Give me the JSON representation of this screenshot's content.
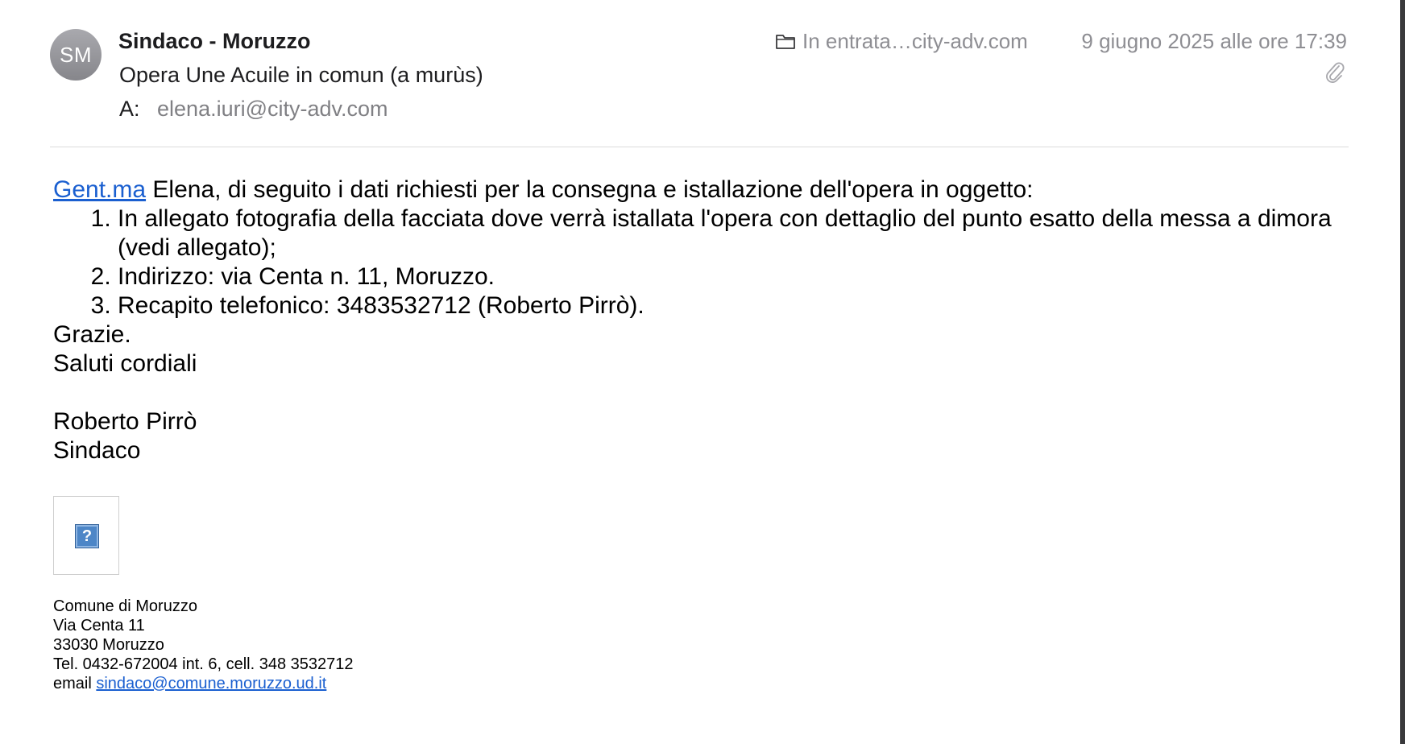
{
  "header": {
    "avatar_initials": "SM",
    "sender_name": "Sindaco - Moruzzo",
    "subject": "Opera Une Acuile in comun (a murùs)",
    "to_label": "A:",
    "to_address": "elena.iuri@city-adv.com",
    "mailbox_icon": "folder-icon",
    "mailbox": "In entrata…city-adv.com",
    "date": "9 giugno 2025 alle ore 17:39",
    "attachment_icon": "paperclip-icon"
  },
  "body": {
    "greeting_link": "Gent.ma",
    "greeting_text": " Elena, di seguito i dati richiesti per la consegna e istallazione dell'opera in oggetto:",
    "items": [
      "In allegato fotografia della facciata dove verrà istallata l'opera con dettaglio del punto esatto della messa a dimora (vedi allegato);",
      "Indirizzo: via Centa n. 11, Moruzzo.",
      "Recapito telefonico: 3483532712 (Roberto Pirrò)."
    ],
    "thanks": "Grazie.",
    "closing": "Saluti cordiali",
    "signer_name": "Roberto Pirrò",
    "signer_role": "Sindaco"
  },
  "signature": {
    "image_icon": "missing-image-icon",
    "image_glyph": "?",
    "line1": "Comune di Moruzzo",
    "line2": "Via Centa 11",
    "line3": "33030 Moruzzo",
    "line4": "Tel. 0432-672004 int. 6, cell. 348 3532712",
    "email_label": "email ",
    "email_link": "sindaco@comune.moruzzo.ud.it"
  },
  "colors": {
    "link": "#1a5fd0",
    "secondary_text": "#8e8e93",
    "avatar_bg": "#96969b"
  }
}
